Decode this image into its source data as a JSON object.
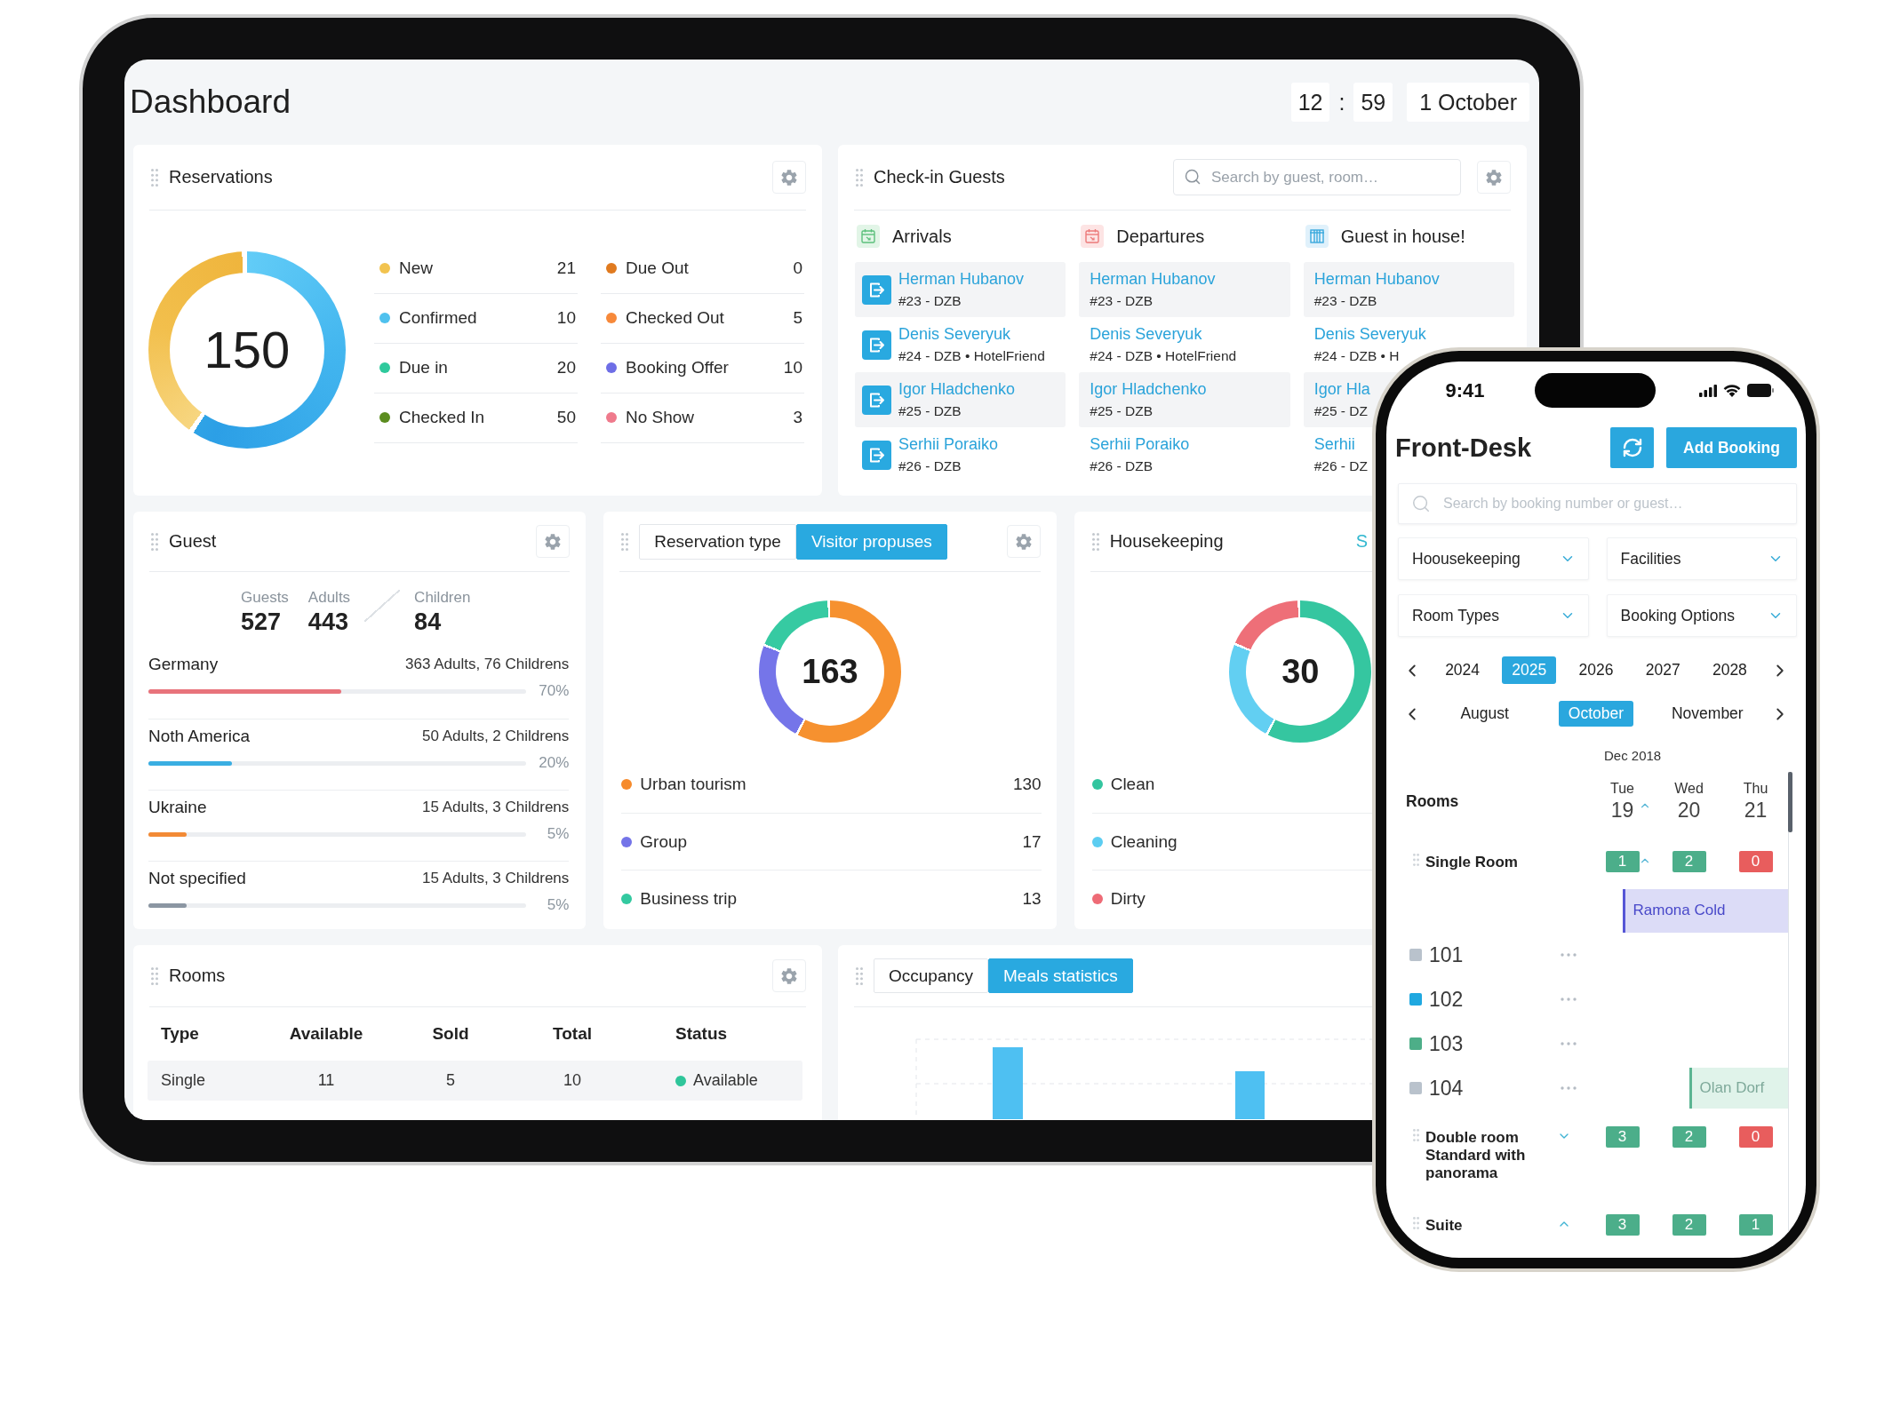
{
  "tablet": {
    "title": "Dashboard",
    "clock": {
      "hours": "12",
      "separator": ":",
      "minutes": "59",
      "date": "1 October"
    },
    "reservations": {
      "title": "Reservations",
      "total": "150",
      "statuses": [
        {
          "label": "New",
          "count": "21",
          "color": "#f2c34f"
        },
        {
          "label": "Confirmed",
          "count": "10",
          "color": "#4fc1ee"
        },
        {
          "label": "Due in",
          "count": "20",
          "color": "#2ec99c"
        },
        {
          "label": "Checked In",
          "count": "50",
          "color": "#5b8c1f"
        },
        {
          "label": "Due Out",
          "count": "0",
          "color": "#e07a1f"
        },
        {
          "label": "Checked Out",
          "count": "5",
          "color": "#f7893a"
        },
        {
          "label": "Booking Offer",
          "count": "10",
          "color": "#6e6ee6"
        },
        {
          "label": "No Show",
          "count": "3",
          "color": "#ef7a8c"
        }
      ]
    },
    "check_in": {
      "title": "Check-in Guests",
      "search": {
        "placeholder": "Search by guest, room…"
      },
      "columns": [
        {
          "kind": "arrivals",
          "title": "Arrivals",
          "guests": [
            {
              "name": "Herman Hubanov",
              "details": "#23 - DZB"
            },
            {
              "name": "Denis Severyuk",
              "details": "#24 - DZB • HotelFriend"
            },
            {
              "name": "Igor Hladchenko",
              "details": "#25 - DZB"
            },
            {
              "name": "Serhii Poraiko",
              "details": "#26 - DZB"
            }
          ]
        },
        {
          "kind": "departures",
          "title": "Departures",
          "guests": [
            {
              "name": "Herman Hubanov",
              "details": "#23 - DZB"
            },
            {
              "name": "Denis Severyuk",
              "details": "#24 - DZB • HotelFriend"
            },
            {
              "name": "Igor Hladchenko",
              "details": "#25 - DZB"
            },
            {
              "name": "Serhii Poraiko",
              "details": "#26 - DZB"
            }
          ]
        },
        {
          "kind": "in_house",
          "title": "Guest in house!",
          "guests": [
            {
              "name": "Herman Hubanov",
              "details": "#23 - DZB"
            },
            {
              "name": "Denis Severyuk",
              "details": "#24 - DZB • H"
            },
            {
              "name": "Igor Hla",
              "details": "#25 - DZ"
            },
            {
              "name": "Serhii",
              "details": "#26 - DZ"
            }
          ]
        }
      ]
    },
    "guest": {
      "title": "Guest",
      "stats": [
        {
          "label": "Guests",
          "value": "527"
        },
        {
          "label": "Adults",
          "value": "443"
        },
        {
          "label": "Children",
          "value": "84"
        }
      ],
      "countries": [
        {
          "name": "Germany",
          "details": "363 Adults, 76 Childrens",
          "percent": "70%",
          "level": 0.51,
          "color": "#e8737b"
        },
        {
          "name": "Noth America",
          "details": "50 Adults, 2 Childrens",
          "percent": "20%",
          "level": 0.22,
          "color": "#3aaee2"
        },
        {
          "name": "Ukraine",
          "details": "15 Adults, 3 Childrens",
          "percent": "5%",
          "level": 0.1,
          "color": "#f28a35"
        },
        {
          "name": "Not specified",
          "details": "15 Adults, 3 Childrens",
          "percent": "5%",
          "level": 0.1,
          "color": "#8b96a2"
        }
      ]
    },
    "reservation_type": {
      "tabs": [
        {
          "label": "Reservation type",
          "selected": false
        },
        {
          "label": "Visitor propuses",
          "selected": true
        }
      ],
      "total": "163",
      "items": [
        {
          "label": "Urban tourism",
          "count": "130",
          "color": "#f68b2c"
        },
        {
          "label": "Group",
          "count": "17",
          "color": "#7474e8"
        },
        {
          "label": "Business trip",
          "count": "13",
          "color": "#33c9a0"
        }
      ]
    },
    "housekeeping": {
      "title": "Housekeeping",
      "link": "S",
      "total": "30",
      "items": [
        {
          "label": "Clean",
          "color": "#33c59f"
        },
        {
          "label": "Cleaning",
          "color": "#5ccdf1"
        },
        {
          "label": "Dirty",
          "color": "#ee6b76"
        }
      ]
    },
    "rooms": {
      "title": "Rooms",
      "columns": [
        "Type",
        "Available",
        "Sold",
        "Total",
        "Status"
      ],
      "rows": [
        {
          "type": "Single",
          "available": "11",
          "sold": "5",
          "total": "10",
          "status": "Available",
          "color": "#2fc59a"
        }
      ]
    },
    "statistics": {
      "tabs": [
        {
          "label": "Occupancy",
          "selected": false
        },
        {
          "label": "Meals statistics",
          "selected": true
        }
      ]
    }
  },
  "phone": {
    "status_bar": {
      "time": "9:41"
    },
    "title": "Front-Desk",
    "add_button": "Add Booking",
    "search": {
      "placeholder": "Search by booking number or guest…"
    },
    "filters": [
      "Hoousekeeping",
      "Facilities",
      "Room Types",
      "Booking Options"
    ],
    "years": [
      {
        "label": "2024",
        "selected": false
      },
      {
        "label": "2025",
        "selected": true
      },
      {
        "label": "2026",
        "selected": false
      },
      {
        "label": "2027",
        "selected": false
      },
      {
        "label": "2028",
        "selected": false
      }
    ],
    "months": [
      {
        "label": "August",
        "selected": false
      },
      {
        "label": "October",
        "selected": true
      },
      {
        "label": "November",
        "selected": false
      }
    ],
    "calendar": {
      "month": "Dec 2018",
      "rooms_label": "Rooms",
      "days": [
        {
          "weekday": "Tue",
          "date": "19",
          "arrow": true
        },
        {
          "weekday": "Wed",
          "date": "20",
          "arrow": false
        },
        {
          "weekday": "Thu",
          "date": "21",
          "arrow": false
        }
      ]
    },
    "room_types": [
      {
        "name": "Single Room",
        "counts": [
          {
            "value": "1",
            "color": "#4cae8a",
            "arrow": true
          },
          {
            "value": "2",
            "color": "#4cae8a",
            "arrow": false
          },
          {
            "value": "0",
            "color": "#e85d5d",
            "arrow": false
          }
        ],
        "bookings": [
          {
            "guest": "Ramona Cold",
            "kind": "reserved",
            "nights": [
              true,
              true,
              true
            ]
          }
        ],
        "rooms": [
          {
            "number": "101",
            "color": "#b9c2cc"
          },
          {
            "number": "102",
            "color": "#1fa8e0"
          },
          {
            "number": "103",
            "color": "#4dae88"
          },
          {
            "number": "104",
            "color": "#b9c2cc",
            "bookings": [
              {
                "guest": "Olan Dorf",
                "kind": "checked_in",
                "nights": [
                  false,
                  true,
                  true
                ]
              }
            ]
          }
        ]
      },
      {
        "name": "Double room Standard with panorama",
        "expanded": false,
        "counts": [
          {
            "value": "3",
            "color": "#4cae8a",
            "arrow": false
          },
          {
            "value": "2",
            "color": "#4cae8a",
            "arrow": false
          },
          {
            "value": "0",
            "color": "#e85d5d",
            "arrow": false
          }
        ]
      },
      {
        "name": "Suite",
        "expanded": true,
        "counts": [
          {
            "value": "3",
            "color": "#4cae8a",
            "arrow": false
          },
          {
            "value": "2",
            "color": "#4cae8a",
            "arrow": false
          },
          {
            "value": "1",
            "color": "#4cae8a",
            "arrow": false
          }
        ]
      }
    ]
  }
}
